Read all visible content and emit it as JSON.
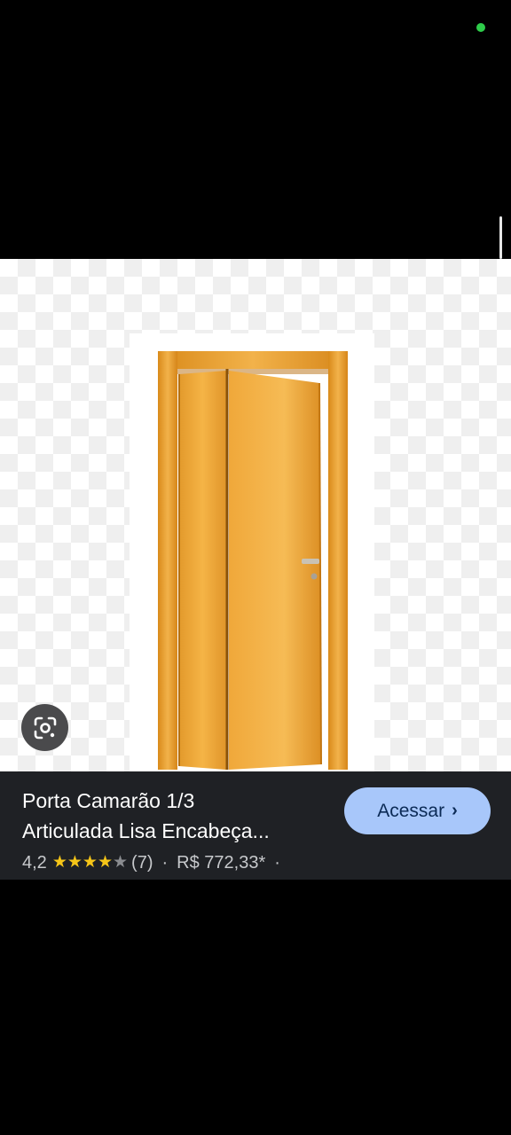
{
  "product": {
    "title_line1": "Porta Camarão 1/3",
    "title_line2": "Articulada Lisa Encabeça...",
    "rating": "4,2",
    "stars": 4.2,
    "reviews": "(7)",
    "separator": "·",
    "price": "R$ 772,33*",
    "trailing_separator": "·"
  },
  "actions": {
    "visit_label": "Acessar",
    "visit_chevron": "›"
  },
  "icons": {
    "lens": "google-lens-icon",
    "star_filled": "★",
    "star_empty": "★"
  },
  "colors": {
    "info_bar_bg": "#1f2125",
    "visit_button_bg": "#a8c7fa",
    "star_color": "#f5c518",
    "status_dot": "#2ecc4a"
  }
}
